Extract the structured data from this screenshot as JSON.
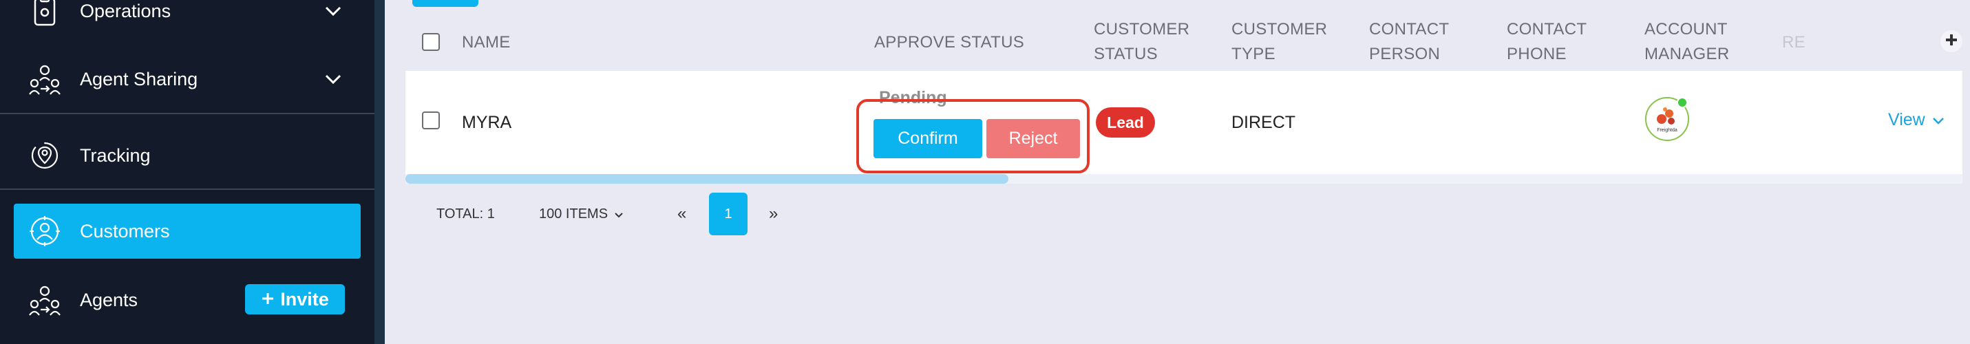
{
  "sidebar": {
    "items": [
      {
        "label": "Operations",
        "icon": "clipboard-icon"
      },
      {
        "label": "Agent Sharing",
        "icon": "agent-sharing-icon"
      },
      {
        "label": "Tracking",
        "icon": "location-pin-icon"
      },
      {
        "label": "Customers",
        "icon": "customers-icon",
        "active": true
      },
      {
        "label": "Agents",
        "icon": "agents-icon"
      }
    ],
    "invite_label": "Invite"
  },
  "table": {
    "headers": {
      "name": "NAME",
      "approve_status": "APPROVE STATUS",
      "customer_status": [
        "CUSTOMER",
        "STATUS"
      ],
      "customer_type": [
        "CUSTOMER",
        "TYPE"
      ],
      "contact_person": [
        "CONTACT",
        "PERSON"
      ],
      "contact_phone": [
        "CONTACT",
        "PHONE"
      ],
      "account_manager": [
        "ACCOUNT",
        "MANAGER"
      ],
      "truncated": "RE"
    },
    "rows": [
      {
        "name": "MYRA",
        "approve_status": "Pending",
        "confirm_label": "Confirm",
        "reject_label": "Reject",
        "customer_status": "Lead",
        "customer_type": "DIRECT",
        "contact_person": "",
        "contact_phone": "",
        "account_manager_logo_text": "Freightda",
        "view_label": "View"
      }
    ]
  },
  "pagination": {
    "total": "TOTAL: 1",
    "items_per_page": "100 ITEMS",
    "prev": "«",
    "current_page": "1",
    "next": "»"
  },
  "colors": {
    "sidebar_bg": "#131b2a",
    "accent": "#0bb4ef",
    "reject": "#f07878",
    "lead": "#e0322c",
    "highlight": "#e23a2a",
    "page_bg": "#e9e9f3"
  }
}
